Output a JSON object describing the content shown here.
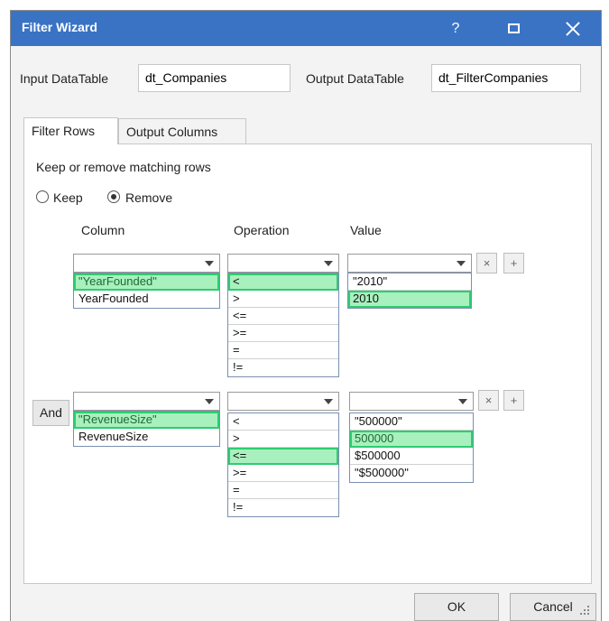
{
  "window": {
    "title": "Filter Wizard",
    "help": "?"
  },
  "io": {
    "input_label": "Input DataTable",
    "input_value": "dt_Companies",
    "output_label": "Output DataTable",
    "output_value": "dt_FilterCompanies"
  },
  "tabs": [
    {
      "label": "Filter Rows",
      "active": true
    },
    {
      "label": "Output Columns",
      "active": false
    }
  ],
  "filter": {
    "heading": "Keep or remove matching rows",
    "keep_label": "Keep",
    "remove_label": "Remove",
    "selected_mode": "Remove",
    "col_header": "Column",
    "op_header": "Operation",
    "val_header": "Value",
    "and_label": "And",
    "remove_symbol": "×",
    "add_symbol": "+"
  },
  "row1": {
    "column_options": [
      "\"YearFounded\"",
      "YearFounded"
    ],
    "operation_options": [
      "<",
      ">",
      "<=",
      ">=",
      "=",
      "!="
    ],
    "value_options": [
      "\"2010\"",
      "2010"
    ],
    "highlighted": {
      "column": "\"YearFounded\"",
      "operation": "<",
      "value": "2010"
    }
  },
  "row2": {
    "column_options": [
      "\"RevenueSize\"",
      "RevenueSize"
    ],
    "operation_options": [
      "<",
      ">",
      "<=",
      ">=",
      "=",
      "!="
    ],
    "value_options": [
      "\"500000\"",
      "500000",
      "$500000",
      "\"$500000\""
    ],
    "highlighted": {
      "column": "\"RevenueSize\"",
      "operation": "<=",
      "value": "500000"
    }
  },
  "buttons": {
    "ok": "OK",
    "cancel": "Cancel"
  },
  "colors": {
    "titlebar": "#3a73c4",
    "highlight_fill": "#a8f0bd",
    "highlight_border": "#2ecc71"
  }
}
